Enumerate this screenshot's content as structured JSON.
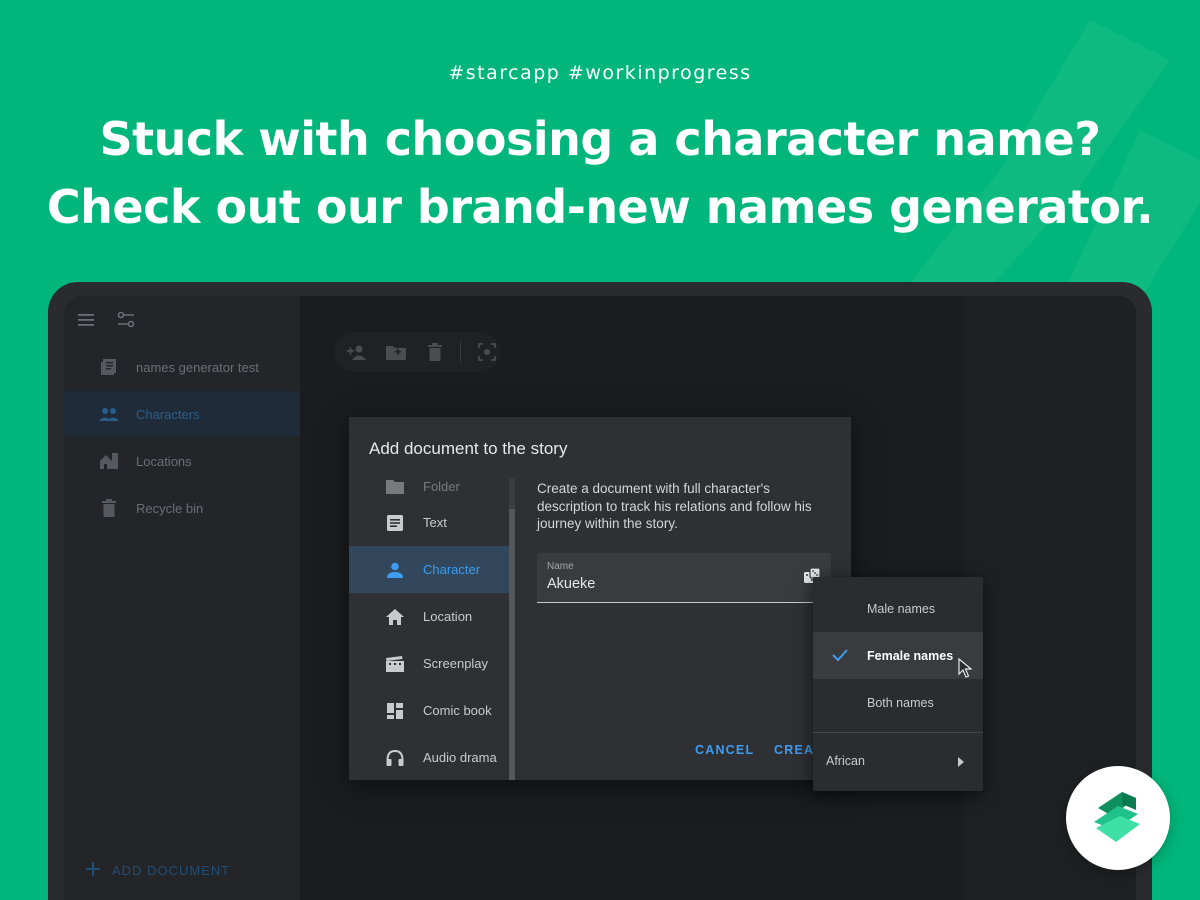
{
  "promo": {
    "hashtags": "#starcapp  #workinprogress",
    "headline_line1": "Stuck with choosing a character name?",
    "headline_line2": "Check out our brand-new names generator."
  },
  "colors": {
    "background": "#00b67a",
    "accent": "#3d9cf0",
    "dialog": "#2f3034",
    "sidebar": "#242529"
  },
  "sidebar": {
    "items": [
      {
        "label": "names generator test",
        "icon": "book-icon"
      },
      {
        "label": "Characters",
        "icon": "people-icon",
        "active": true
      },
      {
        "label": "Locations",
        "icon": "city-icon"
      },
      {
        "label": "Recycle bin",
        "icon": "trash-icon"
      }
    ],
    "add_document": "ADD DOCUMENT"
  },
  "toolbar": {
    "icons": [
      "add-person-icon",
      "add-folder-icon",
      "trash-icon",
      "focus-icon"
    ]
  },
  "dialog": {
    "title": "Add document to the story",
    "types": [
      {
        "label": "Folder",
        "icon": "folder-icon"
      },
      {
        "label": "Text",
        "icon": "text-icon"
      },
      {
        "label": "Character",
        "icon": "person-icon",
        "active": true
      },
      {
        "label": "Location",
        "icon": "home-icon"
      },
      {
        "label": "Screenplay",
        "icon": "clapper-icon"
      },
      {
        "label": "Comic book",
        "icon": "comic-icon"
      },
      {
        "label": "Audio drama",
        "icon": "headphones-icon"
      }
    ],
    "description": "Create a document with full character's description to track his relations and follow his journey within the story.",
    "name_field": {
      "label": "Name",
      "value": "Akueke"
    },
    "cancel_label": "CANCEL",
    "create_label": "CREAT"
  },
  "name_menu": {
    "items": [
      "Male names",
      "Female names",
      "Both names"
    ],
    "selected": "Female names",
    "submenu": "African"
  }
}
